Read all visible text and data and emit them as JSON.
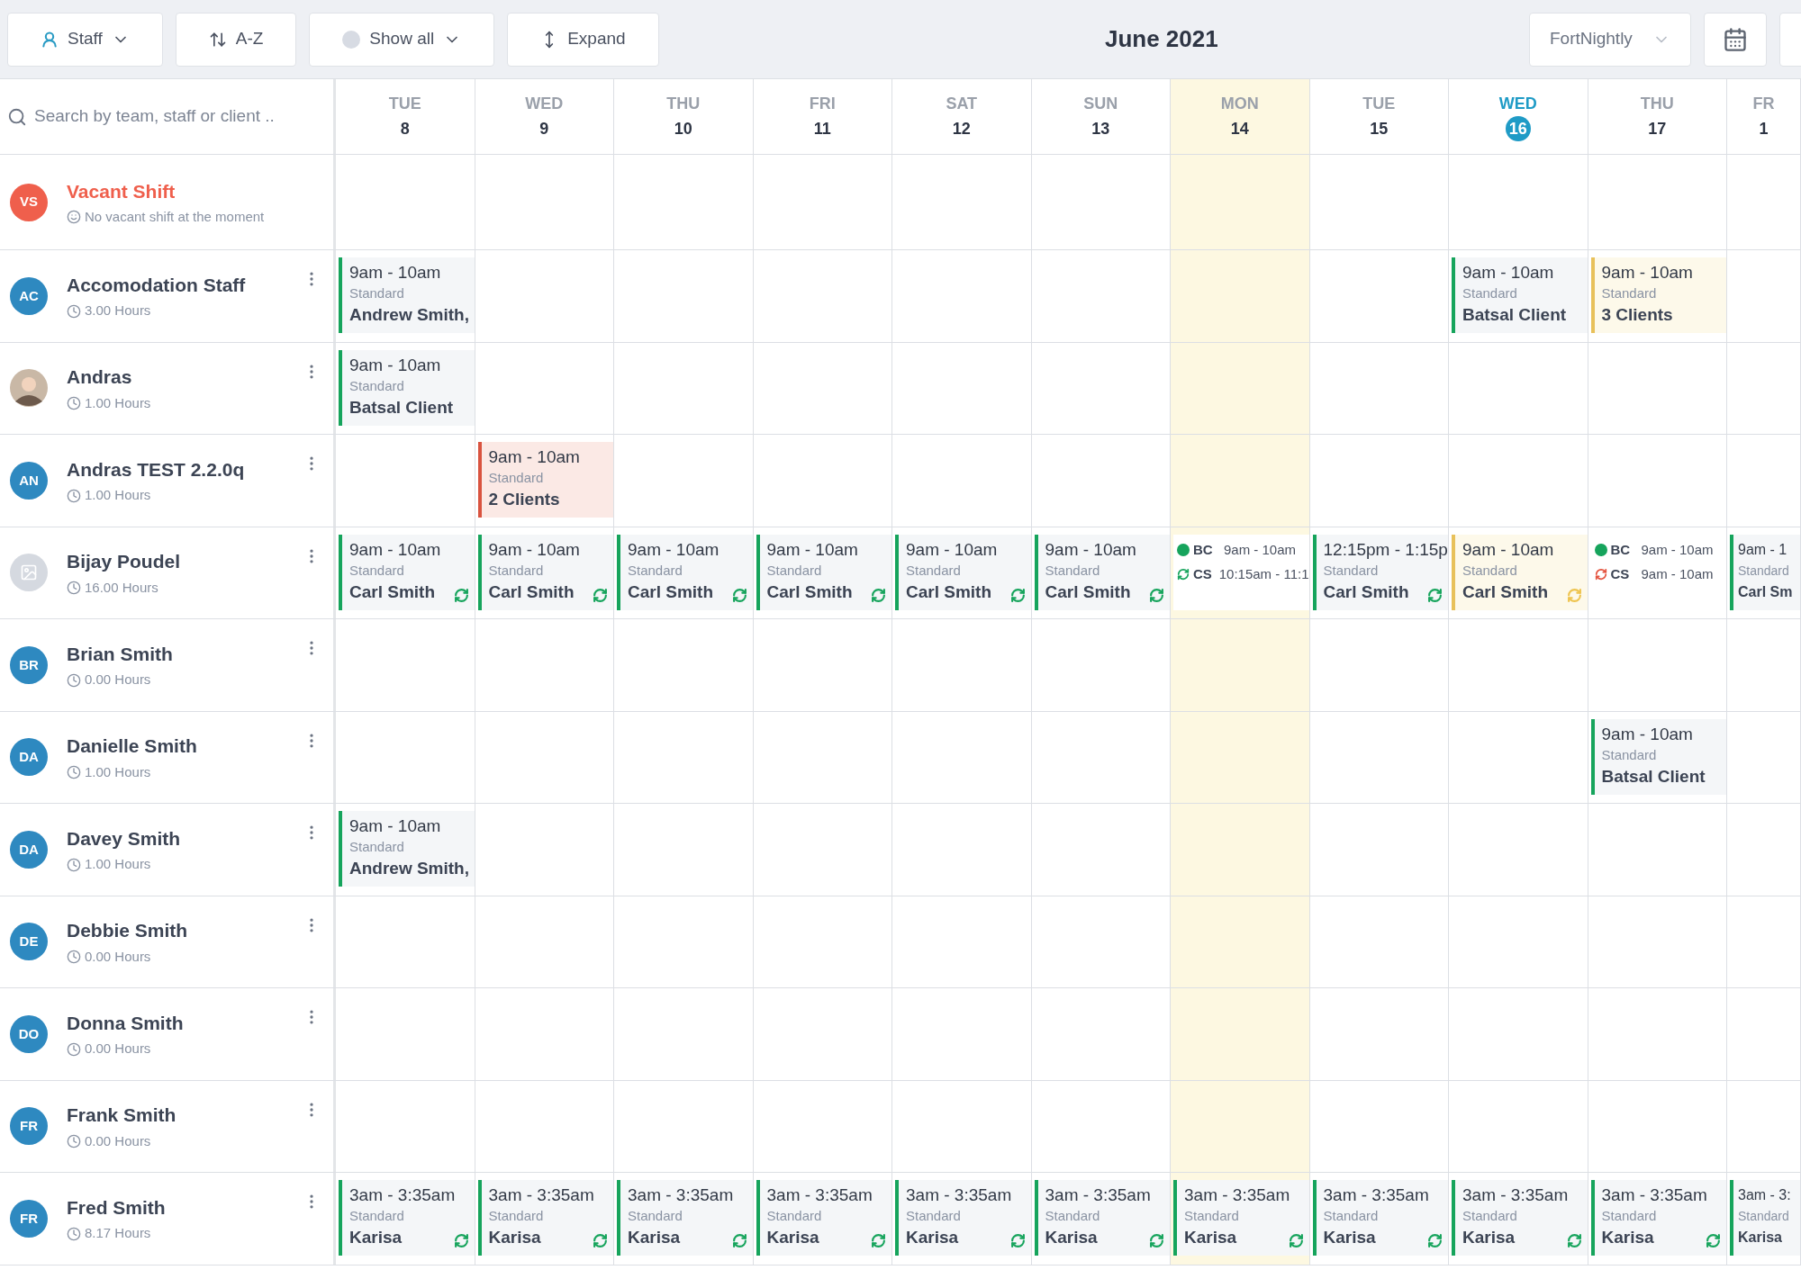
{
  "toolbar": {
    "buttons": [
      {
        "kind": "staff",
        "label": "Staff",
        "dropdown": true
      },
      {
        "kind": "sort",
        "label": "A-Z",
        "dropdown": false
      },
      {
        "kind": "filter",
        "label": "Show all",
        "dropdown": true
      },
      {
        "kind": "expand",
        "label": "Expand",
        "dropdown": false
      }
    ],
    "title": "June 2021",
    "view_select": "FortNightly"
  },
  "search": {
    "placeholder": "Search by team, staff or client .."
  },
  "days": [
    {
      "day": "TUE",
      "date": "8",
      "selected": false,
      "highlighted": false
    },
    {
      "day": "WED",
      "date": "9",
      "selected": false,
      "highlighted": false
    },
    {
      "day": "THU",
      "date": "10",
      "selected": false,
      "highlighted": false
    },
    {
      "day": "FRI",
      "date": "11",
      "selected": false,
      "highlighted": false
    },
    {
      "day": "SAT",
      "date": "12",
      "selected": false,
      "highlighted": false
    },
    {
      "day": "SUN",
      "date": "13",
      "selected": false,
      "highlighted": false
    },
    {
      "day": "MON",
      "date": "14",
      "selected": false,
      "highlighted": true
    },
    {
      "day": "TUE",
      "date": "15",
      "selected": false,
      "highlighted": false
    },
    {
      "day": "WED",
      "date": "16",
      "selected": true,
      "highlighted": false
    },
    {
      "day": "THU",
      "date": "17",
      "selected": false,
      "highlighted": false
    },
    {
      "day": "FR",
      "date": "1",
      "selected": false,
      "highlighted": false
    }
  ],
  "rows": [
    {
      "kind": "vacant",
      "avatar": {
        "kind": "initials",
        "text": "VS"
      },
      "name": "Vacant Shift",
      "subtitle": "No vacant shift at the moment",
      "cells": [
        {
          "kind": "empty"
        },
        {
          "kind": "empty"
        },
        {
          "kind": "empty"
        },
        {
          "kind": "empty"
        },
        {
          "kind": "empty"
        },
        {
          "kind": "empty"
        },
        {
          "kind": "empty"
        },
        {
          "kind": "empty"
        },
        {
          "kind": "empty"
        },
        {
          "kind": "empty"
        },
        {
          "kind": "empty"
        }
      ]
    },
    {
      "kind": "staff",
      "avatar": {
        "kind": "initials",
        "text": "AC"
      },
      "name": "Accomodation Staff",
      "subtitle": "3.00 Hours",
      "cells": [
        {
          "kind": "confirmed",
          "time": "9am - 10am",
          "type": "Standard",
          "client": "Andrew Smith,",
          "repeat": false
        },
        {
          "kind": "empty"
        },
        {
          "kind": "empty"
        },
        {
          "kind": "empty"
        },
        {
          "kind": "empty"
        },
        {
          "kind": "empty"
        },
        {
          "kind": "empty"
        },
        {
          "kind": "empty"
        },
        {
          "kind": "confirmed",
          "time": "9am - 10am",
          "type": "Standard",
          "client": "Batsal Client",
          "repeat": false
        },
        {
          "kind": "pending",
          "time": "9am - 10am",
          "type": "Standard",
          "client": "3 Clients",
          "repeat": false
        },
        {
          "kind": "empty"
        }
      ]
    },
    {
      "kind": "staff",
      "avatar": {
        "kind": "photo"
      },
      "name": "Andras",
      "subtitle": "1.00 Hours",
      "cells": [
        {
          "kind": "confirmed",
          "time": "9am - 10am",
          "type": "Standard",
          "client": "Batsal Client",
          "repeat": false
        },
        {
          "kind": "empty"
        },
        {
          "kind": "empty"
        },
        {
          "kind": "empty"
        },
        {
          "kind": "empty"
        },
        {
          "kind": "empty"
        },
        {
          "kind": "empty"
        },
        {
          "kind": "empty"
        },
        {
          "kind": "empty"
        },
        {
          "kind": "empty"
        },
        {
          "kind": "empty"
        }
      ]
    },
    {
      "kind": "staff",
      "avatar": {
        "kind": "initials",
        "text": "AN"
      },
      "name": "Andras TEST 2.2.0q",
      "subtitle": "1.00 Hours",
      "cells": [
        {
          "kind": "empty"
        },
        {
          "kind": "cancelled",
          "time": "9am - 10am",
          "type": "Standard",
          "client": "2 Clients",
          "repeat": false
        },
        {
          "kind": "empty"
        },
        {
          "kind": "empty"
        },
        {
          "kind": "empty"
        },
        {
          "kind": "empty"
        },
        {
          "kind": "empty"
        },
        {
          "kind": "empty"
        },
        {
          "kind": "empty"
        },
        {
          "kind": "empty"
        },
        {
          "kind": "empty"
        }
      ]
    },
    {
      "kind": "staff",
      "avatar": {
        "kind": "placeholder"
      },
      "name": "Bijay Poudel",
      "subtitle": "16.00 Hours",
      "cells": [
        {
          "kind": "confirmed",
          "time": "9am - 10am",
          "type": "Standard",
          "client": "Carl Smith",
          "repeat": true
        },
        {
          "kind": "confirmed",
          "time": "9am - 10am",
          "type": "Standard",
          "client": "Carl Smith",
          "repeat": true
        },
        {
          "kind": "confirmed",
          "time": "9am - 10am",
          "type": "Standard",
          "client": "Carl Smith",
          "repeat": true
        },
        {
          "kind": "confirmed",
          "time": "9am - 10am",
          "type": "Standard",
          "client": "Carl Smith",
          "repeat": true
        },
        {
          "kind": "confirmed",
          "time": "9am - 10am",
          "type": "Standard",
          "client": "Carl Smith",
          "repeat": true
        },
        {
          "kind": "confirmed",
          "time": "9am - 10am",
          "type": "Standard",
          "client": "Carl Smith",
          "repeat": true
        },
        {
          "kind": "multi",
          "entries": [
            {
              "kind": "dot",
              "color": "#16a45c",
              "code": "BC",
              "time": "9am - 10am"
            },
            {
              "kind": "repeat",
              "color": "#16a45c",
              "code": "CS",
              "time": "10:15am - 11:1"
            }
          ]
        },
        {
          "kind": "confirmed",
          "time": "12:15pm - 1:15p",
          "type": "Standard",
          "client": "Carl Smith",
          "repeat": true
        },
        {
          "kind": "pending",
          "time": "9am - 10am",
          "type": "Standard",
          "client": "Carl Smith",
          "repeat": true
        },
        {
          "kind": "multi",
          "entries": [
            {
              "kind": "dot",
              "color": "#16a45c",
              "code": "BC",
              "time": "9am - 10am"
            },
            {
              "kind": "repeat",
              "color": "#e4533e",
              "code": "CS",
              "time": "9am - 10am"
            }
          ]
        },
        {
          "kind": "confirmed",
          "time": "9am - 1",
          "type": "Standard",
          "client": "Carl Sm",
          "repeat": false
        }
      ]
    },
    {
      "kind": "staff",
      "avatar": {
        "kind": "initials",
        "text": "BR"
      },
      "name": "Brian Smith",
      "subtitle": "0.00 Hours",
      "cells": [
        {
          "kind": "empty"
        },
        {
          "kind": "empty"
        },
        {
          "kind": "empty"
        },
        {
          "kind": "empty"
        },
        {
          "kind": "empty"
        },
        {
          "kind": "empty"
        },
        {
          "kind": "empty"
        },
        {
          "kind": "empty"
        },
        {
          "kind": "empty"
        },
        {
          "kind": "empty"
        },
        {
          "kind": "empty"
        }
      ]
    },
    {
      "kind": "staff",
      "avatar": {
        "kind": "initials",
        "text": "DA"
      },
      "name": "Danielle Smith",
      "subtitle": "1.00 Hours",
      "cells": [
        {
          "kind": "empty"
        },
        {
          "kind": "empty"
        },
        {
          "kind": "empty"
        },
        {
          "kind": "empty"
        },
        {
          "kind": "empty"
        },
        {
          "kind": "empty"
        },
        {
          "kind": "empty"
        },
        {
          "kind": "empty"
        },
        {
          "kind": "empty"
        },
        {
          "kind": "confirmed",
          "time": "9am - 10am",
          "type": "Standard",
          "client": "Batsal Client",
          "repeat": false
        },
        {
          "kind": "empty"
        }
      ]
    },
    {
      "kind": "staff",
      "avatar": {
        "kind": "initials",
        "text": "DA"
      },
      "name": "Davey Smith",
      "subtitle": "1.00 Hours",
      "cells": [
        {
          "kind": "confirmed",
          "time": "9am - 10am",
          "type": "Standard",
          "client": "Andrew Smith,",
          "repeat": false
        },
        {
          "kind": "empty"
        },
        {
          "kind": "empty"
        },
        {
          "kind": "empty"
        },
        {
          "kind": "empty"
        },
        {
          "kind": "empty"
        },
        {
          "kind": "empty"
        },
        {
          "kind": "empty"
        },
        {
          "kind": "empty"
        },
        {
          "kind": "empty"
        },
        {
          "kind": "empty"
        }
      ]
    },
    {
      "kind": "staff",
      "avatar": {
        "kind": "initials",
        "text": "DE"
      },
      "name": "Debbie Smith",
      "subtitle": "0.00 Hours",
      "cells": [
        {
          "kind": "empty"
        },
        {
          "kind": "empty"
        },
        {
          "kind": "empty"
        },
        {
          "kind": "empty"
        },
        {
          "kind": "empty"
        },
        {
          "kind": "empty"
        },
        {
          "kind": "empty"
        },
        {
          "kind": "empty"
        },
        {
          "kind": "empty"
        },
        {
          "kind": "empty"
        },
        {
          "kind": "empty"
        }
      ]
    },
    {
      "kind": "staff",
      "avatar": {
        "kind": "initials",
        "text": "DO"
      },
      "name": "Donna Smith",
      "subtitle": "0.00 Hours",
      "cells": [
        {
          "kind": "empty"
        },
        {
          "kind": "empty"
        },
        {
          "kind": "empty"
        },
        {
          "kind": "empty"
        },
        {
          "kind": "empty"
        },
        {
          "kind": "empty"
        },
        {
          "kind": "empty"
        },
        {
          "kind": "empty"
        },
        {
          "kind": "empty"
        },
        {
          "kind": "empty"
        },
        {
          "kind": "empty"
        }
      ]
    },
    {
      "kind": "staff",
      "avatar": {
        "kind": "initials",
        "text": "FR"
      },
      "name": "Frank Smith",
      "subtitle": "0.00 Hours",
      "cells": [
        {
          "kind": "empty"
        },
        {
          "kind": "empty"
        },
        {
          "kind": "empty"
        },
        {
          "kind": "empty"
        },
        {
          "kind": "empty"
        },
        {
          "kind": "empty"
        },
        {
          "kind": "empty"
        },
        {
          "kind": "empty"
        },
        {
          "kind": "empty"
        },
        {
          "kind": "empty"
        },
        {
          "kind": "empty"
        }
      ]
    },
    {
      "kind": "staff",
      "avatar": {
        "kind": "initials",
        "text": "FR"
      },
      "name": "Fred Smith",
      "subtitle": "8.17 Hours",
      "cells": [
        {
          "kind": "confirmed",
          "time": "3am - 3:35am",
          "type": "Standard",
          "client": "Karisa",
          "repeat": true
        },
        {
          "kind": "confirmed",
          "time": "3am - 3:35am",
          "type": "Standard",
          "client": "Karisa",
          "repeat": true
        },
        {
          "kind": "confirmed",
          "time": "3am - 3:35am",
          "type": "Standard",
          "client": "Karisa",
          "repeat": true
        },
        {
          "kind": "confirmed",
          "time": "3am - 3:35am",
          "type": "Standard",
          "client": "Karisa",
          "repeat": true
        },
        {
          "kind": "confirmed",
          "time": "3am - 3:35am",
          "type": "Standard",
          "client": "Karisa",
          "repeat": true
        },
        {
          "kind": "confirmed",
          "time": "3am - 3:35am",
          "type": "Standard",
          "client": "Karisa",
          "repeat": true
        },
        {
          "kind": "confirmed",
          "time": "3am - 3:35am",
          "type": "Standard",
          "client": "Karisa",
          "repeat": true
        },
        {
          "kind": "confirmed",
          "time": "3am - 3:35am",
          "type": "Standard",
          "client": "Karisa",
          "repeat": true
        },
        {
          "kind": "confirmed",
          "time": "3am - 3:35am",
          "type": "Standard",
          "client": "Karisa",
          "repeat": true
        },
        {
          "kind": "confirmed",
          "time": "3am - 3:35am",
          "type": "Standard",
          "client": "Karisa",
          "repeat": true
        },
        {
          "kind": "confirmed",
          "time": "3am - 3:",
          "type": "Standard",
          "client": "Karisa",
          "repeat": false
        }
      ]
    }
  ]
}
